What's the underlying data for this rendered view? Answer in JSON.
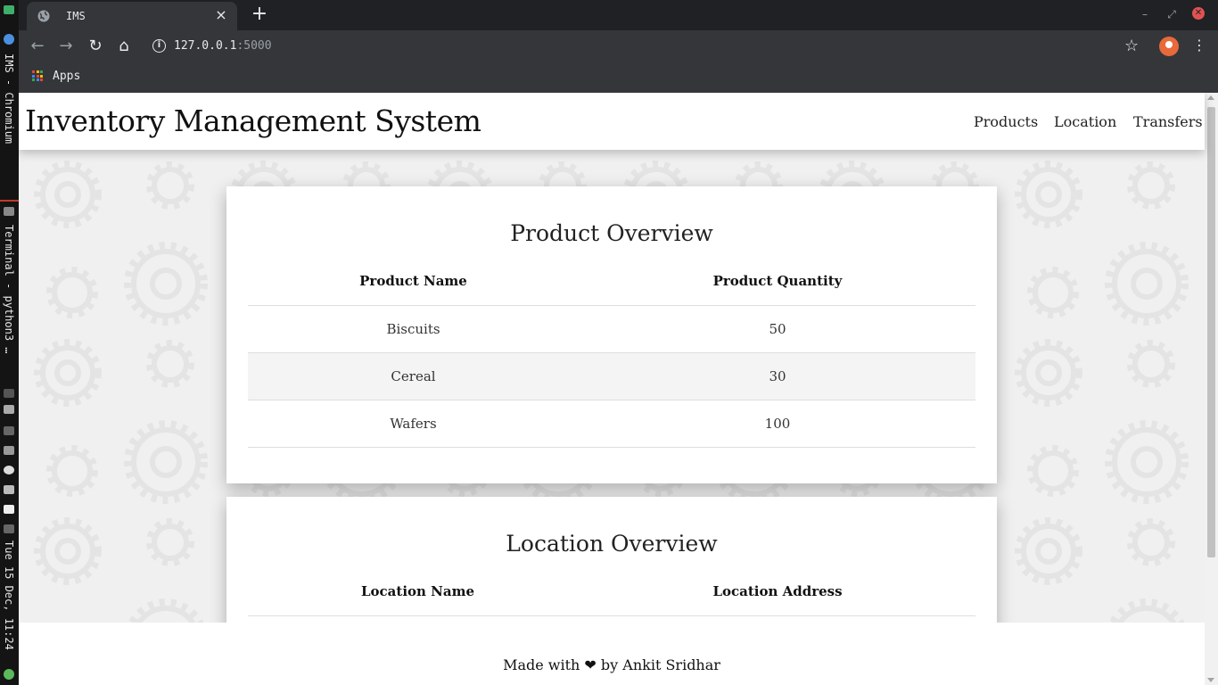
{
  "os_panel": {
    "window_label": "IMS - Chromium",
    "terminal_label": "Terminal - python3 …",
    "clock": "Tue 15 Dec, 11:24"
  },
  "browser": {
    "tab_title": "IMS",
    "tab_close": "×",
    "new_tab": "+",
    "url_host": "127.0.0.1",
    "url_port": ":5000",
    "bookmark_apps": "Apps"
  },
  "site": {
    "title": "Inventory Management System",
    "nav": [
      "Products",
      "Location",
      "Transfers"
    ]
  },
  "product_overview": {
    "heading": "Product Overview",
    "columns": [
      "Product Name",
      "Product Quantity"
    ],
    "rows": [
      {
        "name": "Biscuits",
        "quantity": "50"
      },
      {
        "name": "Cereal",
        "quantity": "30"
      },
      {
        "name": "Wafers",
        "quantity": "100"
      }
    ]
  },
  "location_overview": {
    "heading": "Location Overview",
    "columns": [
      "Location Name",
      "Location Address"
    ]
  },
  "footer": {
    "text": "Made with ❤ by Ankit Sridhar"
  },
  "colors": {
    "browser_dark": "#202124",
    "toolbar": "#35363a",
    "page_bg": "#f0f0f0",
    "card_bg": "#ffffff",
    "alt_row": "#f4f4f4",
    "close_button": "#e05252"
  }
}
